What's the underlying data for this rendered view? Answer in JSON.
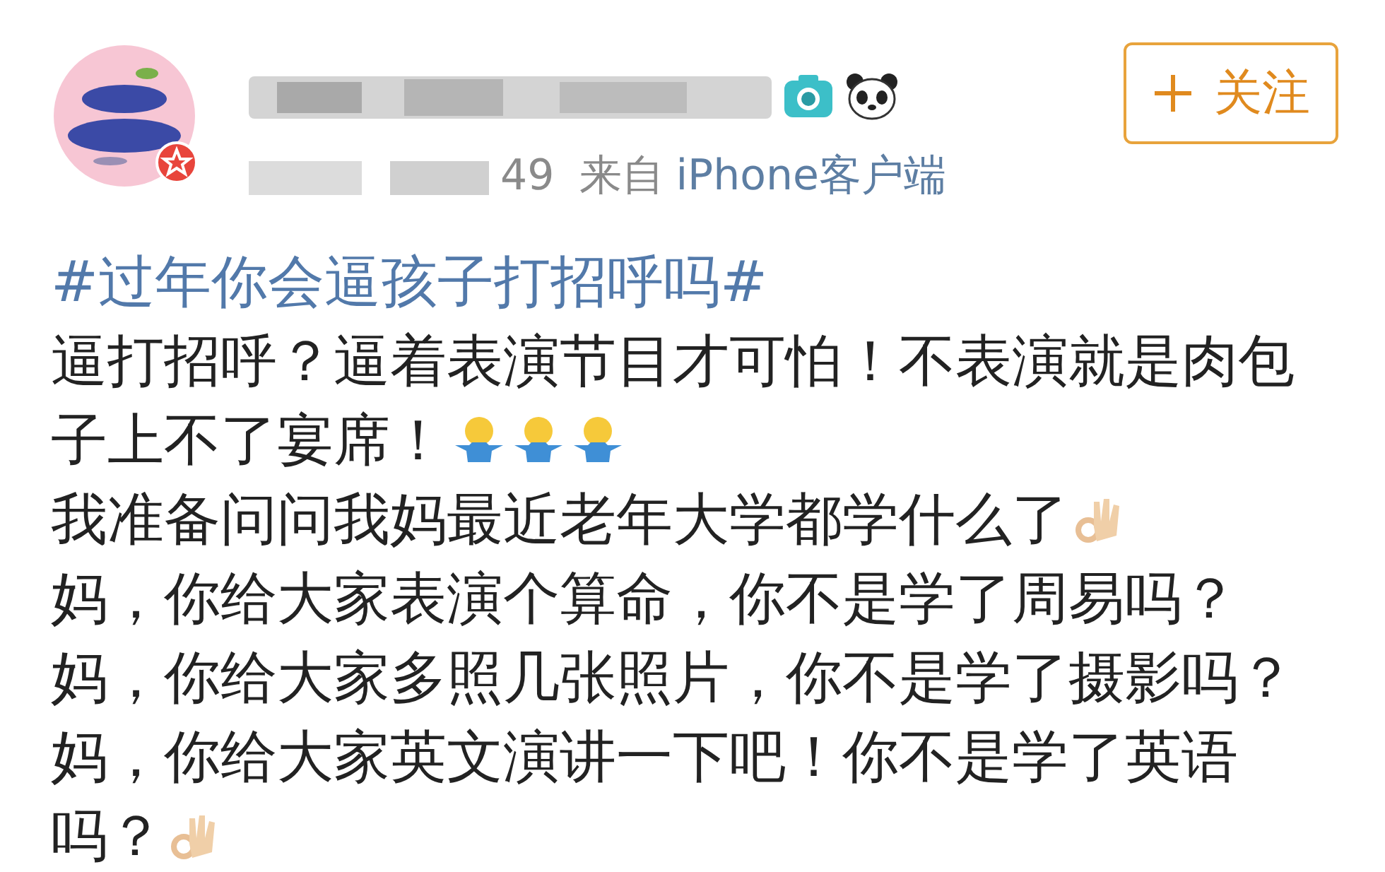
{
  "post": {
    "author": {
      "time": "49",
      "source_prefix": "来自",
      "source": "iPhone客户端"
    },
    "follow_button": {
      "label": "关注"
    },
    "hashtag": "#过年你会逼孩子打招呼吗#",
    "paragraphs": [
      {
        "text": "逼打招呼？逼着表演节目才可怕！不表演就是肉包子上不了宴席！",
        "emojis": [
          {
            "kind": "shrug"
          },
          {
            "kind": "shrug"
          },
          {
            "kind": "shrug"
          }
        ]
      },
      {
        "text": "我准备问问我妈最近老年大学都学什么了",
        "emojis": [
          {
            "kind": "okhand"
          }
        ]
      },
      {
        "text": "妈，你给大家表演个算命，你不是学了周易吗？"
      },
      {
        "text": "妈，你给大家多照几张照片，你不是学了摄影吗？"
      },
      {
        "text": "妈，你给大家英文演讲一下吧！你不是学了英语吗？",
        "emojis": [
          {
            "kind": "okhand"
          }
        ]
      }
    ]
  }
}
